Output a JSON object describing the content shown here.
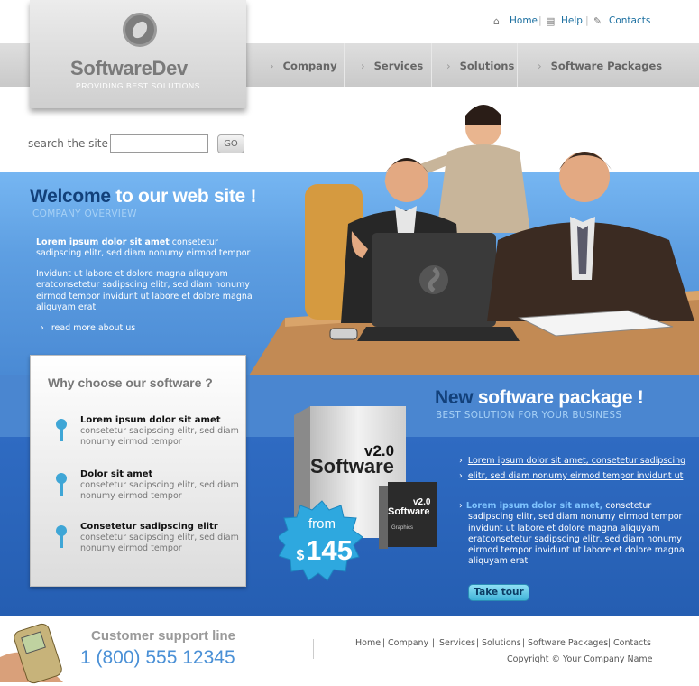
{
  "brand": {
    "name": "SoftwareDev",
    "tagline": "PROVIDING BEST SOLUTIONS"
  },
  "top_links": [
    {
      "label": "Home",
      "icon": "home-icon"
    },
    {
      "label": "Help",
      "icon": "help-icon"
    },
    {
      "label": "Contacts",
      "icon": "contacts-icon"
    }
  ],
  "nav": [
    "Company",
    "Services",
    "Solutions",
    "Software Packages"
  ],
  "search": {
    "label": "search the site",
    "value": "",
    "button": "GO"
  },
  "welcome": {
    "title_highlight": "Welcome",
    "title_rest": " to our web site !",
    "subtitle": "COMPANY OVERVIEW",
    "para1_link": "Lorem ipsum dolor sit amet",
    "para1_line1_rest": " consetetur",
    "para1_line2": "sadipscing elitr, sed diam nonumy eirmod tempor",
    "para2_lines": [
      "Invidunt ut labore et dolore magna aliquyam",
      "eratconsetetur sadipscing elitr, sed diam nonumy",
      "eirmod tempor invidunt ut labore et dolore magna",
      "aliquyam erat"
    ],
    "read_more": "read more about us"
  },
  "why": {
    "title": "Why choose our software ?",
    "items": [
      {
        "title": "Lorem ipsum dolor sit amet",
        "lines": [
          "consetetur sadipscing elitr, sed diam",
          "nonumy eirmod tempor"
        ]
      },
      {
        "title": "Dolor sit amet",
        "lines": [
          "consetetur sadipscing elitr, sed diam",
          "nonumy eirmod tempor"
        ]
      },
      {
        "title": "Consetetur sadipscing elitr",
        "lines": [
          "consetetur sadipscing elitr, sed diam",
          "nonumy eirmod tempor"
        ]
      }
    ]
  },
  "package": {
    "title_highlight": "New",
    "title_rest": " software package !",
    "subtitle": "BEST SOLUTION FOR YOUR BUSINESS",
    "box_version": "v2.0",
    "box_name": "Software",
    "box_small_label": "Graphics",
    "price_from": "from",
    "price_currency": "$",
    "price_value": "145",
    "links": [
      "Lorem ipsum dolor sit amet, consetetur sadipscing",
      "elitr, sed diam nonumy eirmod tempor invidunt ut"
    ],
    "desc_lead": "Lorem ipsum dolor sit amet,",
    "desc_line1_rest": " consetetur",
    "desc_lines": [
      "sadipscing elitr, sed diam nonumy eirmod tempor",
      "invidunt ut labore et dolore magna aliquyam",
      "eratconsetetur sadipscing elitr, sed diam nonumy",
      "eirmod tempor invidunt ut labore et dolore magna",
      "aliquyam erat"
    ],
    "cta": "Take tour"
  },
  "footer": {
    "support_title": "Customer support line",
    "support_phone": "1 (800) 555 12345",
    "links": [
      "Home",
      "Company",
      "Services",
      "Solutions",
      "Software Packages",
      "Contacts"
    ],
    "copyright": "Copyright © Your Company Name"
  },
  "colors": {
    "accent_dark": "#12407a",
    "link_blue": "#1b6fa0",
    "band_light": "#5e9fe2",
    "band_dark": "#255eb2",
    "badge": "#2ea8df"
  }
}
